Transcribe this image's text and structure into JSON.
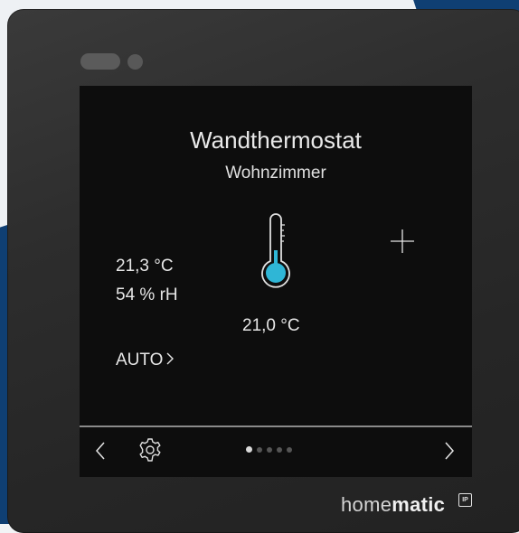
{
  "device": {
    "title": "Wandthermostat",
    "subtitle": "Wohnzimmer"
  },
  "climate": {
    "current_temperature": "21,3 °C",
    "humidity": "54 % rH",
    "setpoint": "21,0 °C",
    "mode_label": "AUTO"
  },
  "navigation": {
    "page_count": 5,
    "active_page": 1
  },
  "brand": {
    "prefix": "home",
    "bold": "matic",
    "badge": "IP"
  },
  "colors": {
    "accent": "#2fb6d6",
    "screen_bg": "#0d0d0d",
    "bezel": "#2e2e2e",
    "wall_blue": "#0f3f73"
  },
  "icons": {
    "thermometer": "thermometer-icon",
    "plus": "plus-icon",
    "settings": "gear-icon",
    "prev": "chevron-left-icon",
    "next": "chevron-right-icon",
    "mode_arrow": "chevron-right-icon"
  }
}
